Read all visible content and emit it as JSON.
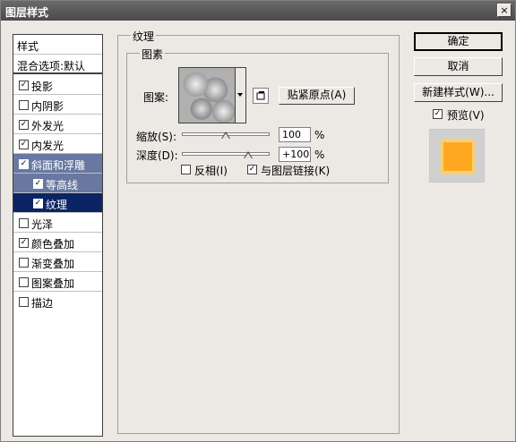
{
  "window": {
    "title": "图层样式",
    "close_label": "×"
  },
  "styles_panel": {
    "header": "样式",
    "blend_options": "混合选项:默认",
    "items": [
      {
        "label": "投影",
        "checked": true
      },
      {
        "label": "内阴影",
        "checked": false
      },
      {
        "label": "外发光",
        "checked": true
      },
      {
        "label": "内发光",
        "checked": true
      },
      {
        "label": "斜面和浮雕",
        "checked": true
      },
      {
        "label": "等高线",
        "checked": true
      },
      {
        "label": "纹理",
        "checked": true
      },
      {
        "label": "光泽",
        "checked": false
      },
      {
        "label": "颜色叠加",
        "checked": true
      },
      {
        "label": "渐变叠加",
        "checked": false
      },
      {
        "label": "图案叠加",
        "checked": false
      },
      {
        "label": "描边",
        "checked": false
      }
    ]
  },
  "texture": {
    "group_title": "纹理",
    "subgroup_title": "图素",
    "pattern_label": "图案:",
    "snap_button": "贴紧原点(A)",
    "scale_label": "缩放(S):",
    "scale_value": "100",
    "scale_unit": "%",
    "scale_level": 0.5,
    "depth_label": "深度(D):",
    "depth_value": "+100",
    "depth_unit": "%",
    "depth_level": 0.75,
    "invert_label": "反相(I)",
    "invert_checked": false,
    "link_label": "与图层链接(K)",
    "link_checked": true
  },
  "buttons": {
    "ok": "确定",
    "cancel": "取消",
    "new_style": "新建样式(W)...",
    "preview_label": "预览(V)",
    "preview_checked": true
  },
  "colors": {
    "selected": "#0a2464",
    "highlight": "#6878a0",
    "preview_swatch": "#ffa820"
  }
}
